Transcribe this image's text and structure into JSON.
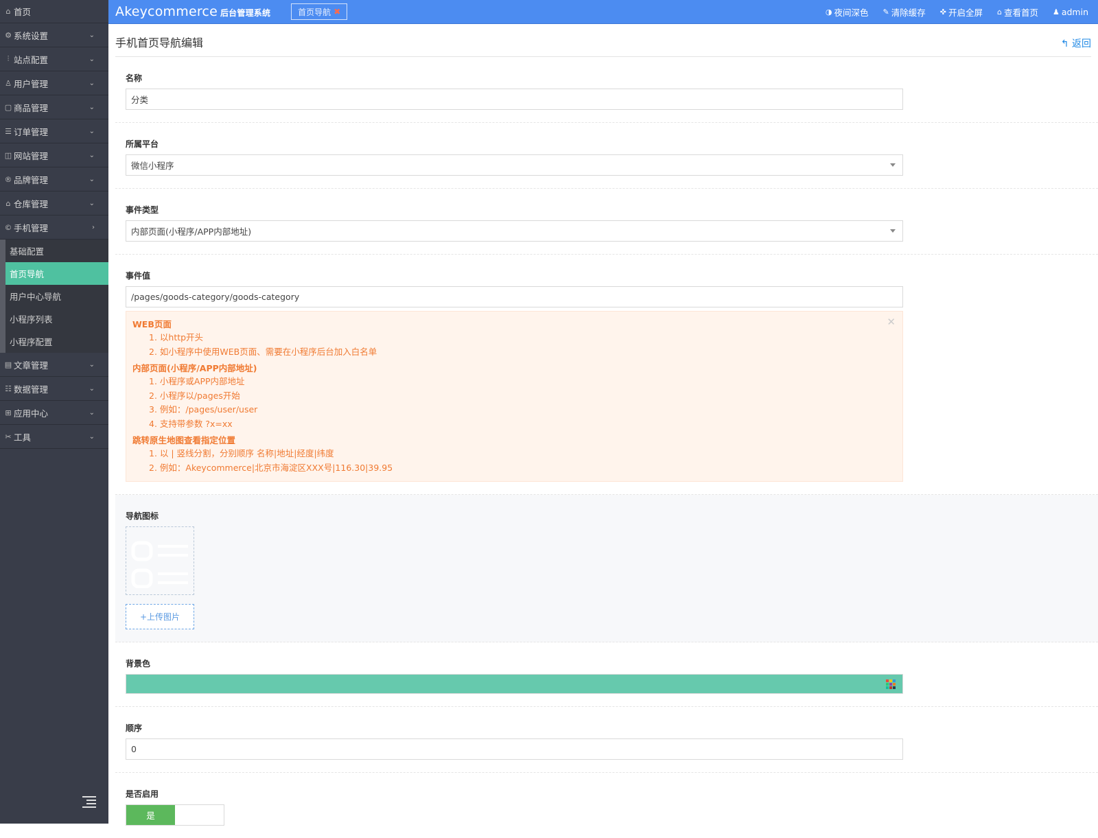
{
  "header": {
    "brand": "Akeycommerce",
    "brand_sub": "后台管理系统",
    "tab_label": "首页导航",
    "night_mode": "夜间深色",
    "clear_cache": "清除缓存",
    "fullscreen": "开启全屏",
    "view_home": "查看首页",
    "user": "admin"
  },
  "sidebar": {
    "home": "首页",
    "items_top": [
      {
        "label": "系统设置",
        "icon": "gear-icon"
      },
      {
        "label": "站点配置",
        "icon": "sliders-icon"
      },
      {
        "label": "用户管理",
        "icon": "user-icon"
      },
      {
        "label": "商品管理",
        "icon": "bag-icon"
      },
      {
        "label": "订单管理",
        "icon": "list-icon"
      },
      {
        "label": "网站管理",
        "icon": "web-icon"
      },
      {
        "label": "品牌管理",
        "icon": "registered-icon"
      },
      {
        "label": "仓库管理",
        "icon": "warehouse-icon"
      },
      {
        "label": "手机管理",
        "icon": "mobile-icon"
      }
    ],
    "submenu": [
      "基础配置",
      "首页导航",
      "用户中心导航",
      "小程序列表",
      "小程序配置"
    ],
    "items_bottom": [
      {
        "label": "文章管理",
        "icon": "article-icon"
      },
      {
        "label": "数据管理",
        "icon": "database-icon"
      },
      {
        "label": "应用中心",
        "icon": "apps-icon"
      },
      {
        "label": "工具",
        "icon": "tools-icon"
      }
    ]
  },
  "page": {
    "title": "手机首页导航编辑",
    "back": "返回"
  },
  "form": {
    "name_label": "名称",
    "name_value": "分类",
    "platform_label": "所属平台",
    "platform_value": "微信小程序",
    "event_type_label": "事件类型",
    "event_type_value": "内部页面(小程序/APP内部地址)",
    "event_value_label": "事件值",
    "event_value": "/pages/goods-category/goods-category",
    "tips": {
      "web_title": "WEB页面",
      "web_1": "1. 以http开头",
      "web_2": "2. 如小程序中使用WEB页面、需要在小程序后台加入白名单",
      "inner_title": "内部页面(小程序/APP内部地址)",
      "inner_1": "1. 小程序或APP内部地址",
      "inner_2": "2. 小程序以/pages开始",
      "inner_3": "3. 例如：/pages/user/user",
      "inner_4": "4. 支持带参数 ?x=xx",
      "map_title": "跳转原生地图查看指定位置",
      "map_1": "1. 以 | 竖线分割，分别顺序 名称|地址|经度|纬度",
      "map_2": "2. 例如：Akeycommerce|北京市海淀区XXX号|116.30|39.95"
    },
    "icon_label": "导航图标",
    "upload_label": "+上传图片",
    "bg_color_label": "背景色",
    "bg_color": "#66c9ad",
    "sort_label": "顺序",
    "sort_value": "0",
    "enabled_label": "是否启用",
    "enabled_on": "是"
  }
}
